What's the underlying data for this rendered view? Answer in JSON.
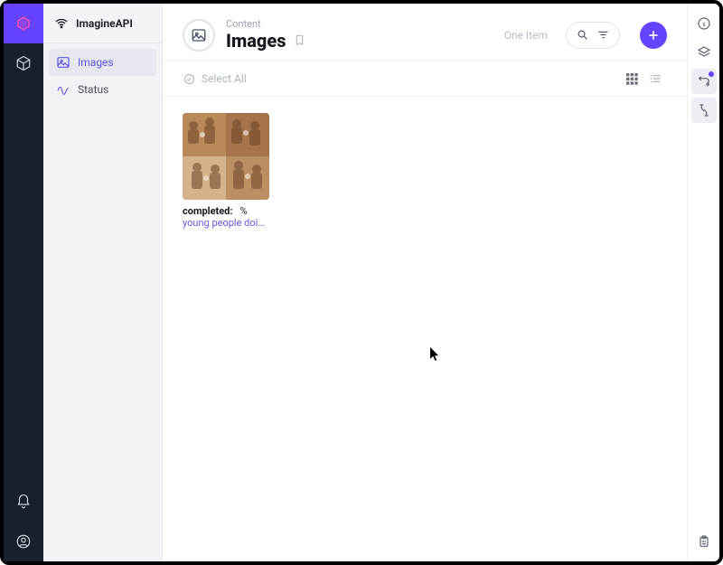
{
  "brand": {
    "name": "ImagineAPI"
  },
  "rail": {
    "items": [
      {
        "name": "logo"
      },
      {
        "name": "content-module",
        "icon": "cube"
      }
    ],
    "footer": [
      {
        "name": "notifications",
        "icon": "bell"
      },
      {
        "name": "account",
        "icon": "user-circle"
      }
    ]
  },
  "sidebar": {
    "header_label": "ImagineAPI",
    "items": [
      {
        "name": "images",
        "label": "Images",
        "icon": "image",
        "active": true
      },
      {
        "name": "status",
        "label": "Status",
        "icon": "status",
        "active": false
      }
    ]
  },
  "header": {
    "breadcrumb": "Content",
    "title": "Images",
    "count_label": "One Item"
  },
  "toolbar": {
    "select_all": "Select All",
    "view": "grid"
  },
  "actions": {
    "search": "Search",
    "filter": "Filter",
    "add": "Create Item"
  },
  "items": [
    {
      "status_label": "completed:",
      "progress_label": "%",
      "caption": "young people doin…"
    }
  ],
  "right_rail": {
    "buttons": [
      {
        "name": "info",
        "active": false
      },
      {
        "name": "layers",
        "active": false
      },
      {
        "name": "transform",
        "active": true,
        "badge": true
      },
      {
        "name": "flow",
        "active": true
      }
    ],
    "footer": {
      "name": "clipboard"
    }
  },
  "colors": {
    "accent": "#6644ff"
  }
}
